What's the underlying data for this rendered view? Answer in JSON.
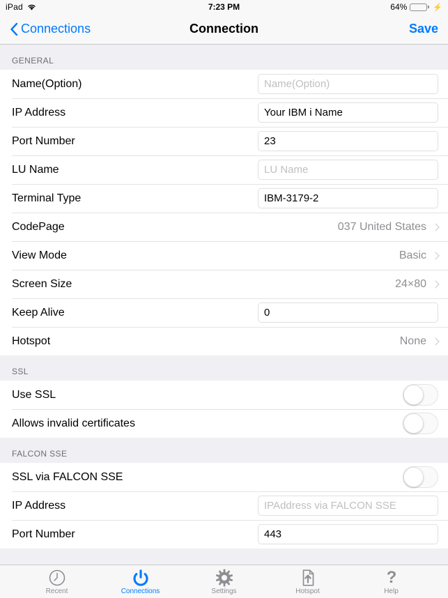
{
  "statusbar": {
    "device": "iPad",
    "wifi_icon": "wifi-icon",
    "time": "7:23 PM",
    "battery_percent": "64%",
    "battery_level": 64,
    "charging": true
  },
  "navbar": {
    "back_label": "Connections",
    "back_icon": "chevron-left-icon",
    "title": "Connection",
    "save_label": "Save"
  },
  "sections": [
    {
      "header": "GENERAL",
      "rows": [
        {
          "type": "input",
          "label": "Name(Option)",
          "value": "",
          "placeholder": "Name(Option)"
        },
        {
          "type": "input",
          "label": "IP Address",
          "value": "Your IBM i Name",
          "placeholder": ""
        },
        {
          "type": "input",
          "label": "Port Number",
          "value": "23",
          "placeholder": ""
        },
        {
          "type": "input",
          "label": "LU Name",
          "value": "",
          "placeholder": "LU Name"
        },
        {
          "type": "input",
          "label": "Terminal Type",
          "value": "IBM-3179-2",
          "placeholder": ""
        },
        {
          "type": "disclosure",
          "label": "CodePage",
          "value": "037 United States"
        },
        {
          "type": "disclosure",
          "label": "View Mode",
          "value": "Basic"
        },
        {
          "type": "disclosure",
          "label": "Screen Size",
          "value": "24×80"
        },
        {
          "type": "input",
          "label": "Keep Alive",
          "value": "0",
          "placeholder": ""
        },
        {
          "type": "disclosure",
          "label": "Hotspot",
          "value": "None"
        }
      ]
    },
    {
      "header": "SSL",
      "rows": [
        {
          "type": "toggle",
          "label": "Use SSL",
          "on": false
        },
        {
          "type": "toggle",
          "label": "Allows invalid certificates",
          "on": false
        }
      ]
    },
    {
      "header": "FALCON SSE",
      "rows": [
        {
          "type": "toggle",
          "label": "SSL via FALCON SSE",
          "on": false
        },
        {
          "type": "input",
          "label": "IP Address",
          "value": "",
          "placeholder": "IPAddress via FALCON SSE"
        },
        {
          "type": "input",
          "label": "Port Number",
          "value": "443",
          "placeholder": ""
        }
      ]
    }
  ],
  "tabbar": {
    "active_index": 1,
    "items": [
      {
        "label": "Recent",
        "icon": "clock-icon"
      },
      {
        "label": "Connections",
        "icon": "power-icon"
      },
      {
        "label": "Settings",
        "icon": "gear-icon"
      },
      {
        "label": "Hotspot",
        "icon": "document-upload-icon"
      },
      {
        "label": "Help",
        "icon": "question-mark-icon"
      }
    ]
  },
  "colors": {
    "accent": "#007AFF",
    "battery_green": "#4CD964",
    "group_bg": "#EFEFF4",
    "header_text": "#6D6D72",
    "value_text": "#8E8E93"
  }
}
